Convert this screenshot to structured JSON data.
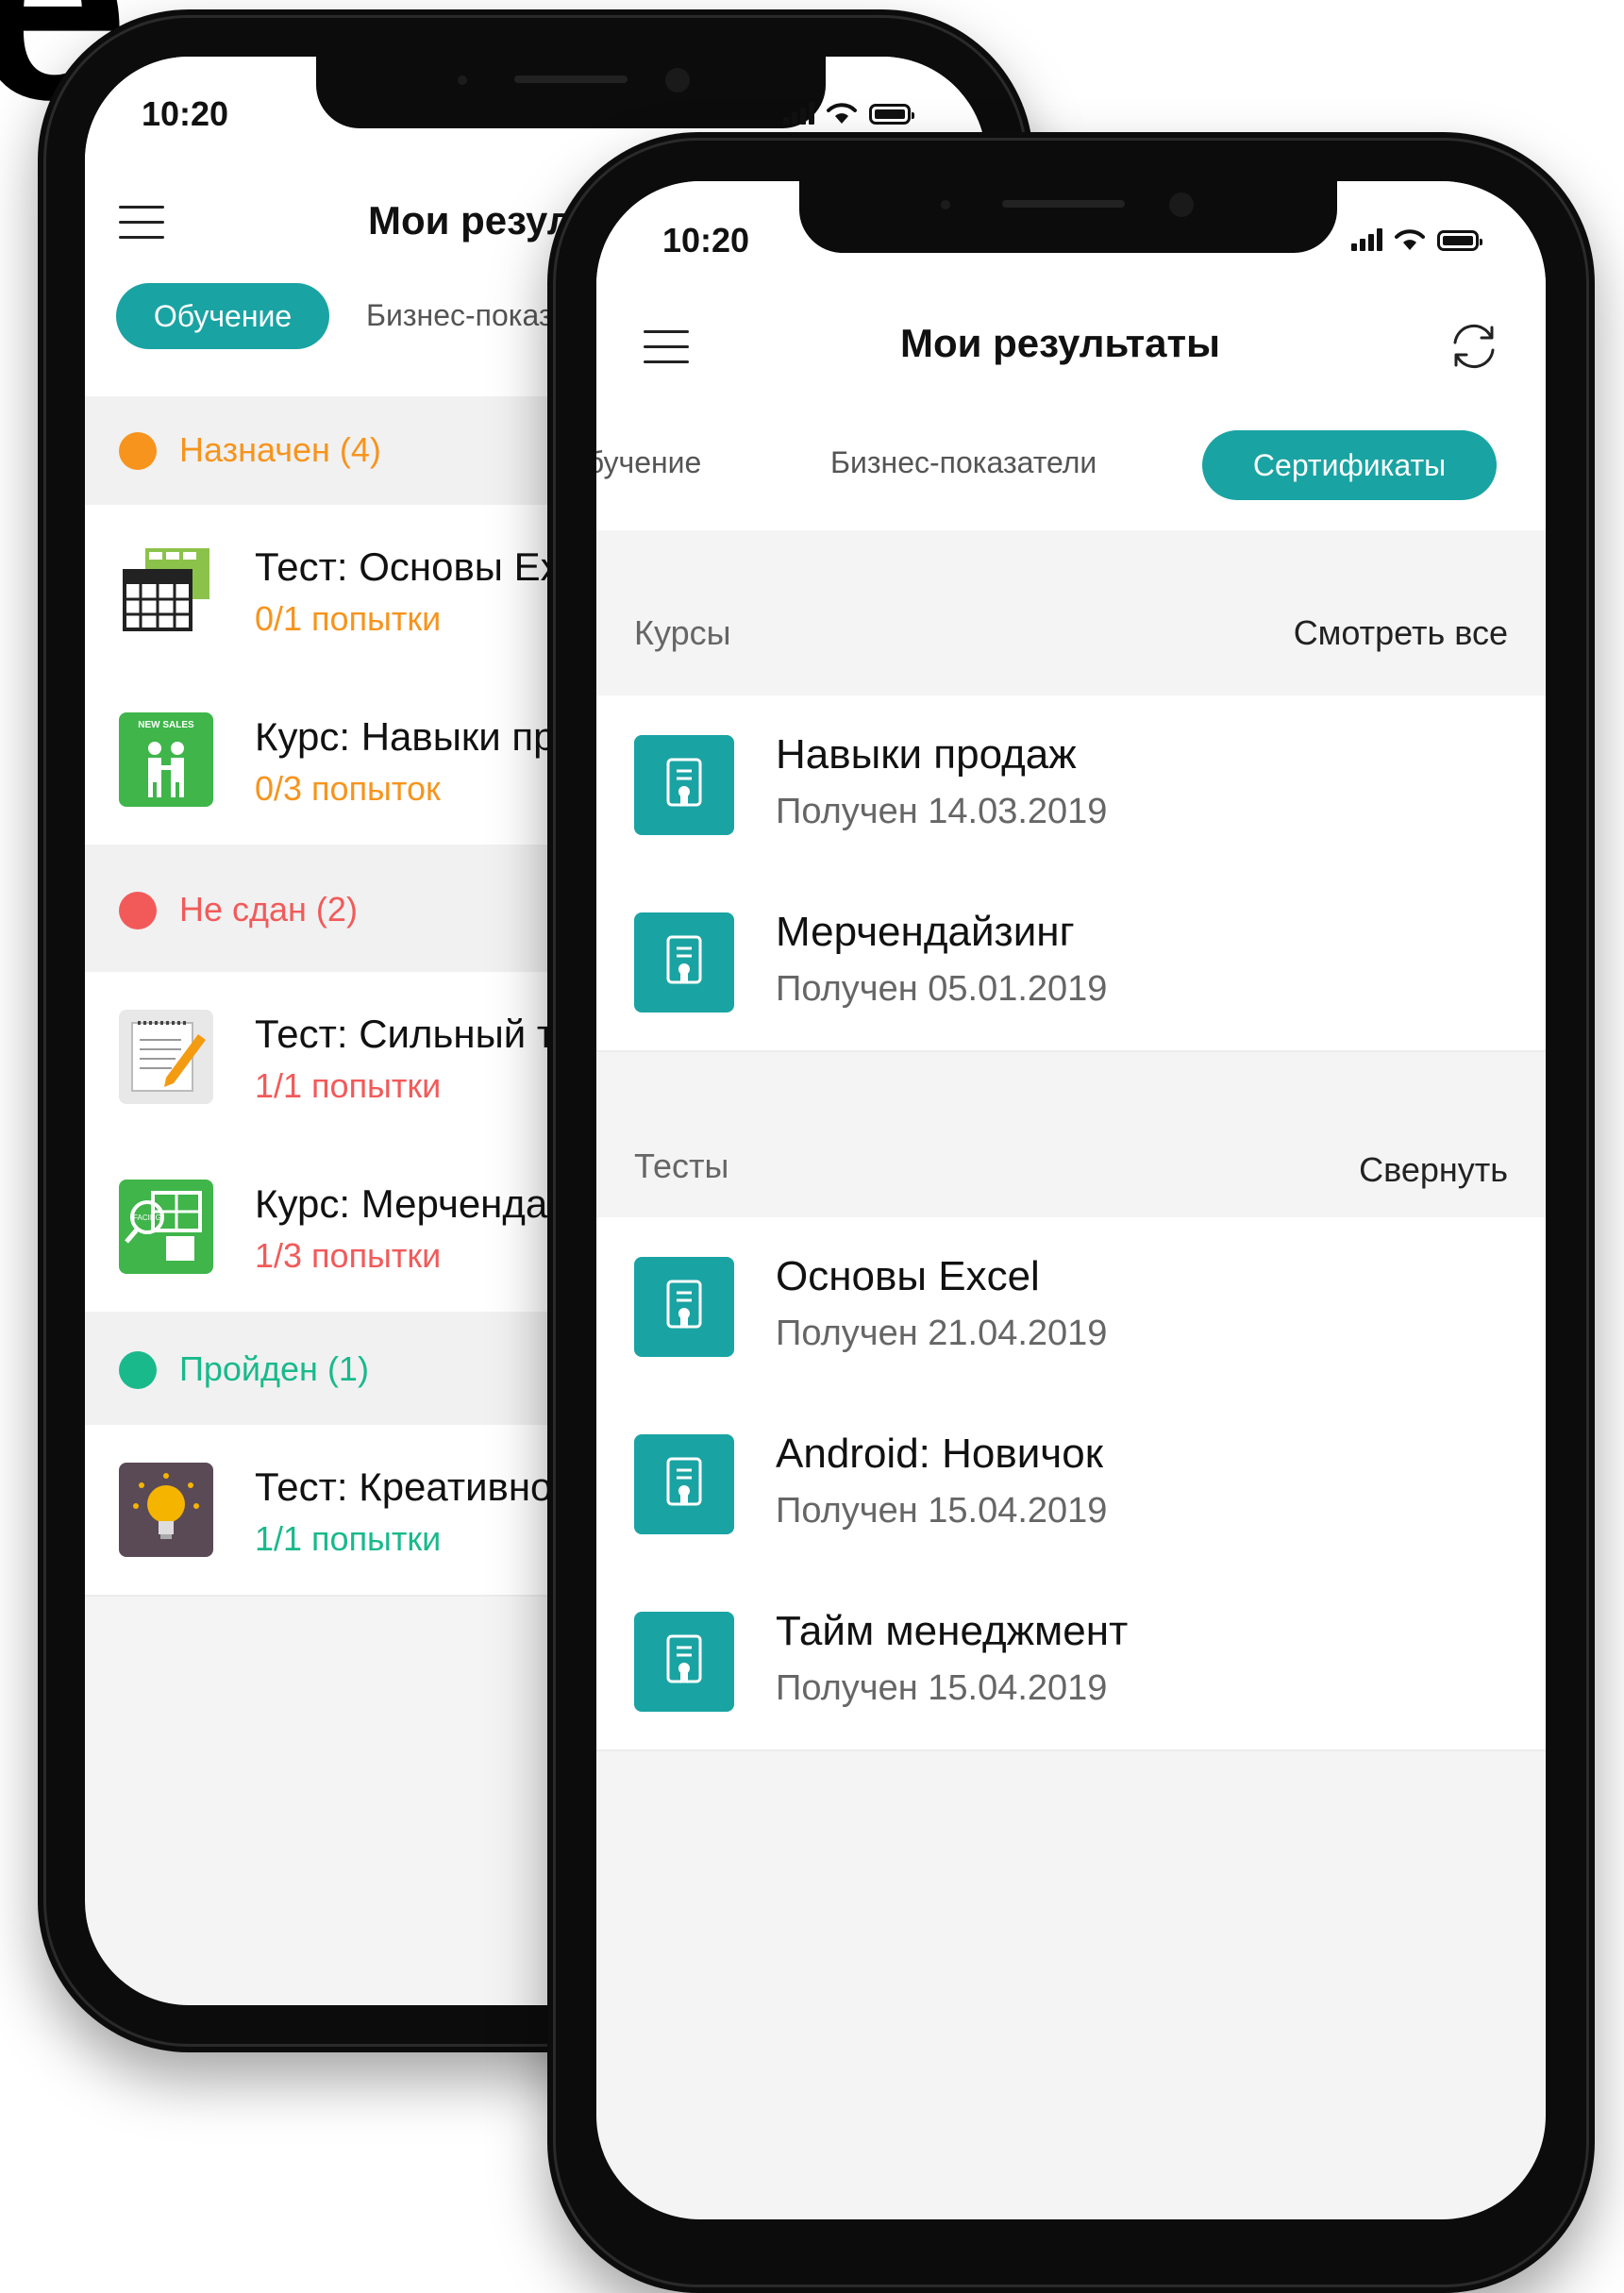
{
  "background": {
    "partial_letter": "e"
  },
  "back_phone": {
    "status_time": "10:20",
    "title": "Мои результаты",
    "tabs": [
      "Обучение",
      "Бизнес-показатели"
    ],
    "sections": [
      {
        "label": "Назначен (4)",
        "color": "#f7941d",
        "items": [
          {
            "title": "Тест: Основы Excel",
            "subtitle": "0/1 попытки",
            "icon": "spreadsheet-thumbnail"
          },
          {
            "title": "Курс: Навыки продаж",
            "subtitle": "0/3 попыток",
            "icon": "new-sales-thumbnail",
            "icon_text": "NEW SALES"
          }
        ]
      },
      {
        "label": "Не сдан (2)",
        "color": "#f25a5a",
        "items": [
          {
            "title": "Тест: Сильный текст",
            "subtitle": "1/1 попытки",
            "icon": "notepad-pencil-thumbnail"
          },
          {
            "title": "Курс: Мерчендайзинг",
            "subtitle": "1/3 попытки",
            "icon": "facing-shelf-thumbnail",
            "icon_text": "FACING"
          }
        ]
      },
      {
        "label": "Пройден (1)",
        "color": "#19b98c",
        "items": [
          {
            "title": "Тест: Креативность",
            "subtitle": "1/1 попытки",
            "icon": "lightbulb-thumbnail"
          }
        ]
      }
    ]
  },
  "front_phone": {
    "status_time": "10:20",
    "title": "Мои результаты",
    "tabs": [
      "Обучение",
      "Бизнес-показатели",
      "Сертификаты"
    ],
    "active_tab": "Сертификаты",
    "accent": "#1aa3a3",
    "courses": {
      "header": "Курсы",
      "action": "Смотреть все",
      "items": [
        {
          "name": "Навыки продаж",
          "date": "Получен 14.03.2019"
        },
        {
          "name": "Мерчендайзинг",
          "date": "Получен 05.01.2019"
        }
      ]
    },
    "tests": {
      "header": "Тесты",
      "action": "Свернуть",
      "items": [
        {
          "name": "Основы Excel",
          "date": "Получен 21.04.2019"
        },
        {
          "name": "Android: Новичок",
          "date": "Получен 15.04.2019"
        },
        {
          "name": "Тайм менеджмент",
          "date": "Получен 15.04.2019"
        }
      ]
    }
  }
}
